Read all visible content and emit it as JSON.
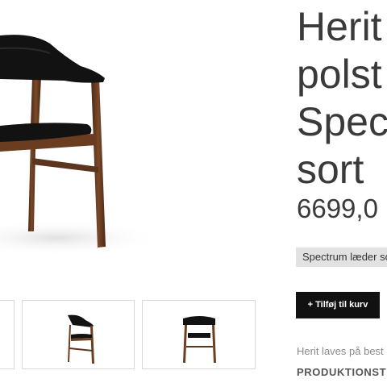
{
  "product": {
    "title_lines": [
      "Herit",
      "polst",
      "Spec",
      "sort"
    ],
    "price": "6699,0",
    "variant_chip": "Spectrum læder so",
    "add_to_cart": "+ Tilføj til kurv",
    "description": "Herit laves på best",
    "production_heading": "PRODUKTIONSTE"
  },
  "images": {
    "hero_icon": "armchair-icon",
    "thumbnails": [
      "armchair-front-icon",
      "armchair-side-icon",
      "armchair-back-icon"
    ]
  },
  "colors": {
    "button_bg": "#111111",
    "chip_bg": "#e2e2e2",
    "wood": "#6b3f22",
    "upholstery": "#111111"
  }
}
